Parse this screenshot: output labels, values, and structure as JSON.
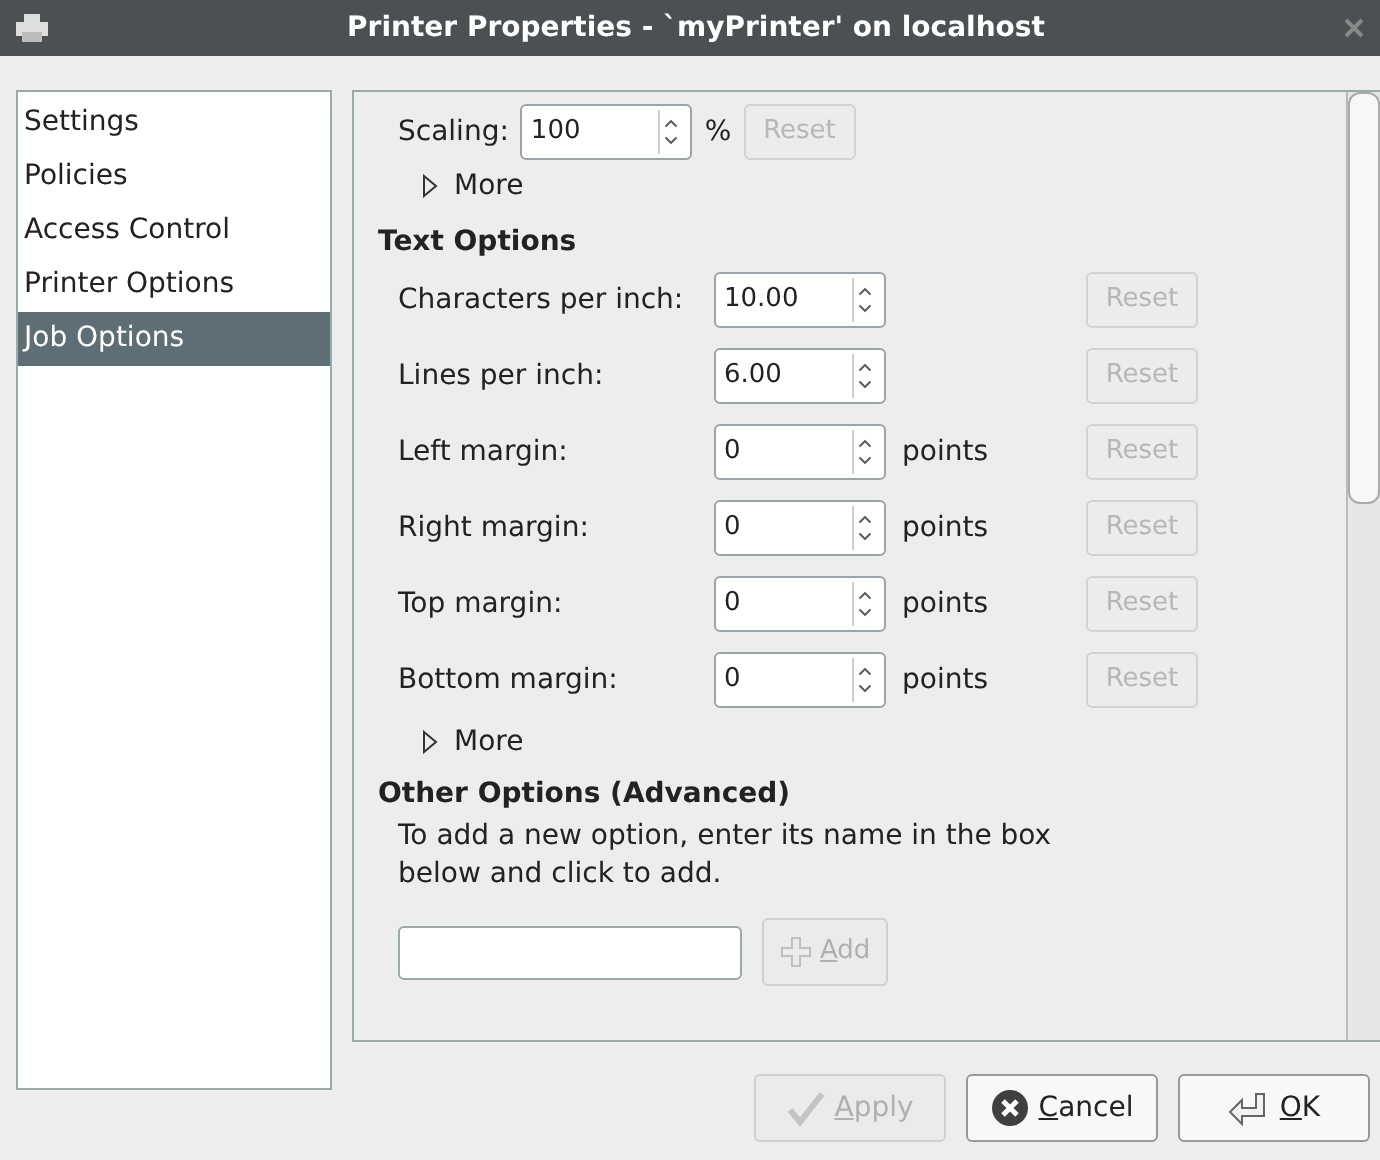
{
  "window": {
    "title": "Printer Properties - `myPrinter' on localhost"
  },
  "sidebar": {
    "items": [
      {
        "label": "Settings",
        "selected": false
      },
      {
        "label": "Policies",
        "selected": false
      },
      {
        "label": "Access Control",
        "selected": false
      },
      {
        "label": "Printer Options",
        "selected": false
      },
      {
        "label": "Job Options",
        "selected": true
      }
    ]
  },
  "scaling": {
    "label": "Scaling:",
    "value": "100",
    "unit": "%",
    "reset": {
      "label": "Reset",
      "disabled": true
    }
  },
  "more_1": {
    "label": "More",
    "expanded": false
  },
  "text_options": {
    "heading": "Text Options",
    "rows": [
      {
        "label": "Characters per inch:",
        "value": "10.00",
        "reset": "Reset"
      },
      {
        "label": "Lines per inch:",
        "value": "6.00",
        "reset": "Reset"
      },
      {
        "label": "Left margin:",
        "value": "0",
        "unit": "points",
        "reset": "Reset"
      },
      {
        "label": "Right margin:",
        "value": "0",
        "unit": "points",
        "reset": "Reset"
      },
      {
        "label": "Top margin:",
        "value": "0",
        "unit": "points",
        "reset": "Reset"
      },
      {
        "label": "Bottom margin:",
        "value": "0",
        "unit": "points",
        "reset": "Reset"
      }
    ]
  },
  "more_2": {
    "label": "More",
    "expanded": false
  },
  "other_options": {
    "heading": "Other Options (Advanced)",
    "description": "To add a new option, enter its name in the box below and click to add.",
    "add": {
      "label": "Add",
      "disabled": true
    }
  },
  "buttons": [
    {
      "label": "Apply",
      "kind": "apply",
      "disabled": true
    },
    {
      "label": "Cancel",
      "kind": "cancel",
      "disabled": false
    },
    {
      "label": "OK",
      "kind": "ok",
      "disabled": false
    }
  ]
}
